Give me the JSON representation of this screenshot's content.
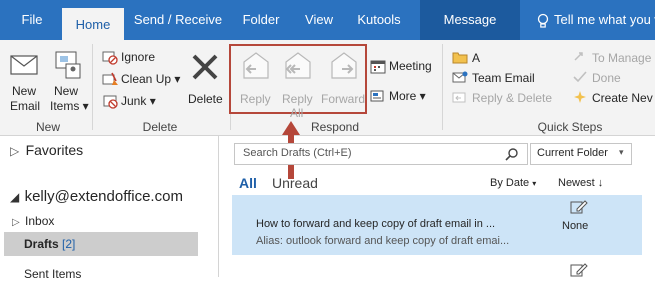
{
  "tabs": [
    {
      "label": "File"
    },
    {
      "label": "Home"
    },
    {
      "label": "Send / Receive"
    },
    {
      "label": "Folder"
    },
    {
      "label": "View"
    },
    {
      "label": "Kutools"
    },
    {
      "label": "Message"
    },
    {
      "label": "Tell me what you wa"
    }
  ],
  "ribbon": {
    "new": {
      "new_email_line1": "New",
      "new_email_line2": "Email",
      "new_items_line1": "New",
      "new_items_line2": "Items",
      "group": "New"
    },
    "delete": {
      "ignore": "Ignore",
      "clean_up": "Clean Up",
      "junk": "Junk",
      "delete": "Delete",
      "group": "Delete"
    },
    "respond": {
      "reply": "Reply",
      "reply_all_line1": "Reply",
      "reply_all_line2": "All",
      "forward": "Forward",
      "meeting": "Meeting",
      "more": "More",
      "group": "Respond"
    },
    "quick_steps": {
      "a": "A",
      "team_email": "Team Email",
      "reply_delete": "Reply & Delete",
      "to_manager": "To Manage",
      "done": "Done",
      "create_new": "Create Nev",
      "group": "Quick Steps"
    }
  },
  "left_pane": {
    "favorites": "Favorites",
    "account": "kelly@extendoffice.com",
    "inbox": "Inbox",
    "drafts": "Drafts",
    "drafts_count": "[2]",
    "sent_items": "Sent Items"
  },
  "mail_list": {
    "search_placeholder": "Search Drafts (Ctrl+E)",
    "scope": "Current Folder",
    "filter_all": "All",
    "filter_unread": "Unread",
    "sort_by": "By Date",
    "order": "Newest",
    "items": [
      {
        "subject": "How to forward and keep copy of draft email in ...",
        "preview": "Alias: outlook forward and keep copy of draft emai...",
        "category": "None"
      }
    ]
  },
  "colors": {
    "accent": "#2b72bf",
    "highlight": "#cde4f7",
    "annotation": "#b5473a"
  }
}
